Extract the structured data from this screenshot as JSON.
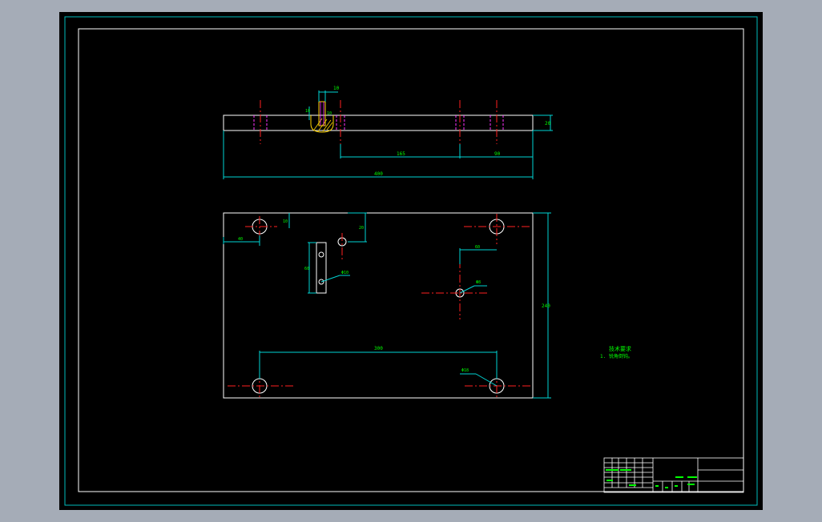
{
  "colors": {
    "background": "#a5acb7",
    "paper": "#000000",
    "frame": "#00bcbc",
    "outline": "#ffffff",
    "dimension": "#00d4d4",
    "dimension_text": "#00ff00",
    "centerline": "#ff2020",
    "hidden": "#ff33ff",
    "hatch": "#ffd400",
    "note_text": "#00ff00"
  },
  "dimensions": {
    "top_view": {
      "slot_width": "10",
      "slot_depth": "10",
      "slot_side": "10",
      "thickness": "20",
      "hole_span": "165",
      "end_span": "90",
      "overall_length": "400"
    },
    "plan_view": {
      "corner_offset_y": "10",
      "corner_offset_x": "40",
      "pin_offset": "20",
      "slot_length": "60",
      "slot_hole": "Φ10",
      "center_offset": "60",
      "center_hole": "Φ8",
      "hole_span": "300",
      "corner_hole": "Φ18",
      "overall_width": "240"
    }
  },
  "notes": {
    "title": "技术要求",
    "line1": "1. 锐角倒钝。"
  },
  "title_block": {
    "label_material": "",
    "label_scale": "",
    "label_weight": ""
  }
}
